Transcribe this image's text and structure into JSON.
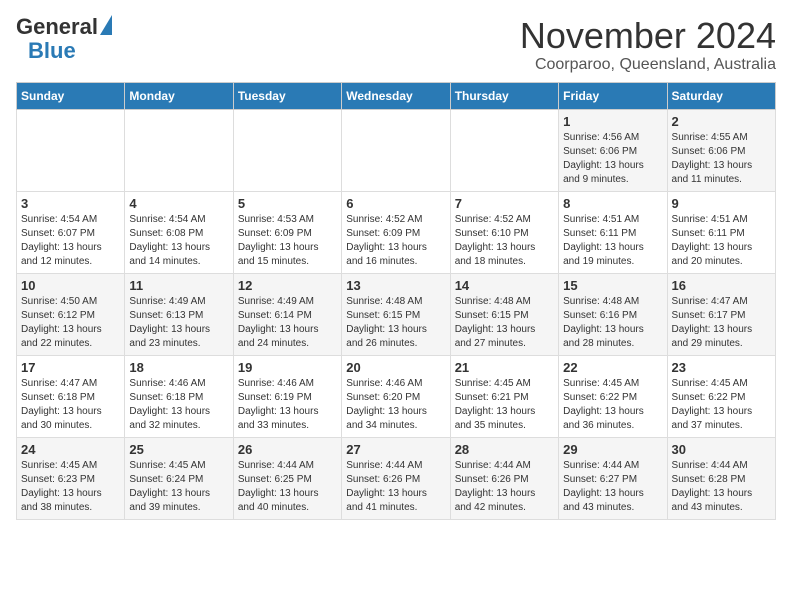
{
  "header": {
    "logo_general": "General",
    "logo_blue": "Blue",
    "title": "November 2024",
    "subtitle": "Coorparoo, Queensland, Australia"
  },
  "days_of_week": [
    "Sunday",
    "Monday",
    "Tuesday",
    "Wednesday",
    "Thursday",
    "Friday",
    "Saturday"
  ],
  "weeks": [
    {
      "days": [
        {
          "num": "",
          "info": ""
        },
        {
          "num": "",
          "info": ""
        },
        {
          "num": "",
          "info": ""
        },
        {
          "num": "",
          "info": ""
        },
        {
          "num": "",
          "info": ""
        },
        {
          "num": "1",
          "info": "Sunrise: 4:56 AM\nSunset: 6:06 PM\nDaylight: 13 hours and 9 minutes."
        },
        {
          "num": "2",
          "info": "Sunrise: 4:55 AM\nSunset: 6:06 PM\nDaylight: 13 hours and 11 minutes."
        }
      ]
    },
    {
      "days": [
        {
          "num": "3",
          "info": "Sunrise: 4:54 AM\nSunset: 6:07 PM\nDaylight: 13 hours and 12 minutes."
        },
        {
          "num": "4",
          "info": "Sunrise: 4:54 AM\nSunset: 6:08 PM\nDaylight: 13 hours and 14 minutes."
        },
        {
          "num": "5",
          "info": "Sunrise: 4:53 AM\nSunset: 6:09 PM\nDaylight: 13 hours and 15 minutes."
        },
        {
          "num": "6",
          "info": "Sunrise: 4:52 AM\nSunset: 6:09 PM\nDaylight: 13 hours and 16 minutes."
        },
        {
          "num": "7",
          "info": "Sunrise: 4:52 AM\nSunset: 6:10 PM\nDaylight: 13 hours and 18 minutes."
        },
        {
          "num": "8",
          "info": "Sunrise: 4:51 AM\nSunset: 6:11 PM\nDaylight: 13 hours and 19 minutes."
        },
        {
          "num": "9",
          "info": "Sunrise: 4:51 AM\nSunset: 6:11 PM\nDaylight: 13 hours and 20 minutes."
        }
      ]
    },
    {
      "days": [
        {
          "num": "10",
          "info": "Sunrise: 4:50 AM\nSunset: 6:12 PM\nDaylight: 13 hours and 22 minutes."
        },
        {
          "num": "11",
          "info": "Sunrise: 4:49 AM\nSunset: 6:13 PM\nDaylight: 13 hours and 23 minutes."
        },
        {
          "num": "12",
          "info": "Sunrise: 4:49 AM\nSunset: 6:14 PM\nDaylight: 13 hours and 24 minutes."
        },
        {
          "num": "13",
          "info": "Sunrise: 4:48 AM\nSunset: 6:15 PM\nDaylight: 13 hours and 26 minutes."
        },
        {
          "num": "14",
          "info": "Sunrise: 4:48 AM\nSunset: 6:15 PM\nDaylight: 13 hours and 27 minutes."
        },
        {
          "num": "15",
          "info": "Sunrise: 4:48 AM\nSunset: 6:16 PM\nDaylight: 13 hours and 28 minutes."
        },
        {
          "num": "16",
          "info": "Sunrise: 4:47 AM\nSunset: 6:17 PM\nDaylight: 13 hours and 29 minutes."
        }
      ]
    },
    {
      "days": [
        {
          "num": "17",
          "info": "Sunrise: 4:47 AM\nSunset: 6:18 PM\nDaylight: 13 hours and 30 minutes."
        },
        {
          "num": "18",
          "info": "Sunrise: 4:46 AM\nSunset: 6:18 PM\nDaylight: 13 hours and 32 minutes."
        },
        {
          "num": "19",
          "info": "Sunrise: 4:46 AM\nSunset: 6:19 PM\nDaylight: 13 hours and 33 minutes."
        },
        {
          "num": "20",
          "info": "Sunrise: 4:46 AM\nSunset: 6:20 PM\nDaylight: 13 hours and 34 minutes."
        },
        {
          "num": "21",
          "info": "Sunrise: 4:45 AM\nSunset: 6:21 PM\nDaylight: 13 hours and 35 minutes."
        },
        {
          "num": "22",
          "info": "Sunrise: 4:45 AM\nSunset: 6:22 PM\nDaylight: 13 hours and 36 minutes."
        },
        {
          "num": "23",
          "info": "Sunrise: 4:45 AM\nSunset: 6:22 PM\nDaylight: 13 hours and 37 minutes."
        }
      ]
    },
    {
      "days": [
        {
          "num": "24",
          "info": "Sunrise: 4:45 AM\nSunset: 6:23 PM\nDaylight: 13 hours and 38 minutes."
        },
        {
          "num": "25",
          "info": "Sunrise: 4:45 AM\nSunset: 6:24 PM\nDaylight: 13 hours and 39 minutes."
        },
        {
          "num": "26",
          "info": "Sunrise: 4:44 AM\nSunset: 6:25 PM\nDaylight: 13 hours and 40 minutes."
        },
        {
          "num": "27",
          "info": "Sunrise: 4:44 AM\nSunset: 6:26 PM\nDaylight: 13 hours and 41 minutes."
        },
        {
          "num": "28",
          "info": "Sunrise: 4:44 AM\nSunset: 6:26 PM\nDaylight: 13 hours and 42 minutes."
        },
        {
          "num": "29",
          "info": "Sunrise: 4:44 AM\nSunset: 6:27 PM\nDaylight: 13 hours and 43 minutes."
        },
        {
          "num": "30",
          "info": "Sunrise: 4:44 AM\nSunset: 6:28 PM\nDaylight: 13 hours and 43 minutes."
        }
      ]
    }
  ]
}
